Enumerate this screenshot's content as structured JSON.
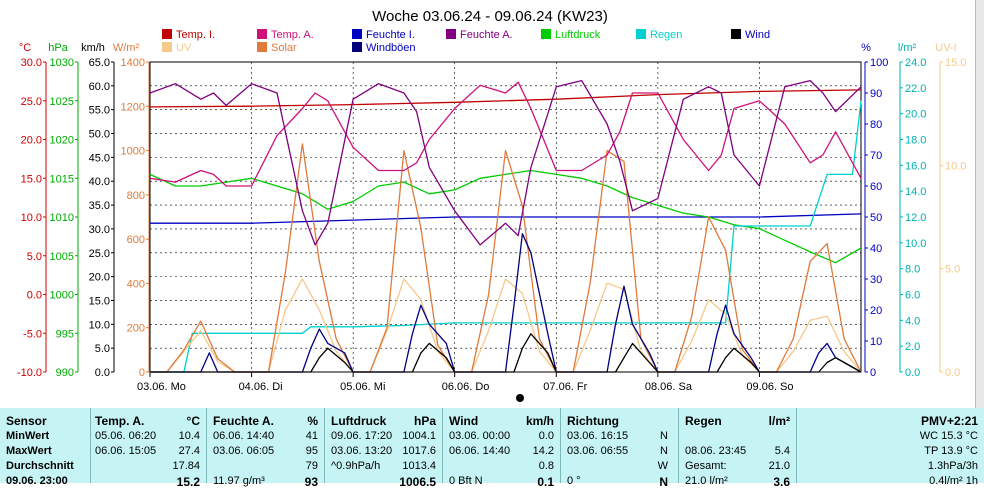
{
  "chart_data": {
    "type": "line",
    "title": "Woche 03.06.24 - 09.06.24 (KW23)",
    "x_ticks": [
      "03.06. Mo",
      "04.06. Di",
      "05.06. Mi",
      "06.06. Do",
      "07.06. Fr",
      "08.06. Sa",
      "09.06. So"
    ],
    "x_range_hours": [
      0,
      168
    ],
    "grid": true,
    "legend_placement": "top",
    "left_axes": [
      {
        "label": "°C",
        "color": "#d00000",
        "range": [
          -10,
          30
        ],
        "ticks": [
          "30.0",
          "25.0",
          "20.0",
          "15.0",
          "10.0",
          "5.0",
          "0.0",
          "-5.0",
          "-10.0"
        ]
      },
      {
        "label": "hPa",
        "color": "#00aa00",
        "range": [
          990,
          1030
        ],
        "ticks": [
          "1030",
          "1025",
          "1020",
          "1015",
          "1010",
          "1005",
          "1000",
          "995",
          "990"
        ]
      },
      {
        "label": "km/h",
        "color": "#000000",
        "range": [
          0,
          65
        ],
        "ticks": [
          "65.0",
          "60.0",
          "55.0",
          "50.0",
          "45.0",
          "40.0",
          "35.0",
          "30.0",
          "25.0",
          "20.0",
          "15.0",
          "10.0",
          "5.0",
          "0.0"
        ]
      },
      {
        "label": "W/m²",
        "color": "#e07a3a",
        "range": [
          0,
          1400
        ],
        "ticks": [
          "1400",
          "1200",
          "1000",
          "800",
          "600",
          "400",
          "200",
          "0"
        ]
      }
    ],
    "right_axes": [
      {
        "label": "%",
        "color": "#0000c0",
        "range": [
          0,
          100
        ],
        "ticks": [
          "100",
          "90",
          "80",
          "70",
          "60",
          "50",
          "40",
          "30",
          "20",
          "10",
          "0"
        ]
      },
      {
        "label": "l/m²",
        "color": "#00b0b0",
        "range": [
          0,
          24
        ],
        "ticks": [
          "24.0",
          "22.0",
          "20.0",
          "18.0",
          "16.0",
          "14.0",
          "12.0",
          "10.0",
          "8.0",
          "6.0",
          "4.0",
          "2.0",
          "0.0"
        ]
      },
      {
        "label": "UV-I",
        "color": "#f5c98a",
        "range": [
          0,
          15
        ],
        "ticks": [
          "15.0",
          "10.0",
          "5.0",
          "0.0"
        ]
      }
    ],
    "series": [
      {
        "name": "Temp. I.",
        "color": "#c00000",
        "axis": "°C",
        "x": [
          0,
          24,
          48,
          72,
          96,
          120,
          144,
          168
        ],
        "y": [
          24.2,
          24.3,
          24.5,
          24.8,
          25.2,
          25.8,
          26.2,
          26.4
        ]
      },
      {
        "name": "Temp. A.",
        "color": "#d0107a",
        "axis": "°C",
        "x": [
          0,
          6,
          12,
          15,
          18,
          24,
          30,
          36,
          39,
          42,
          48,
          54,
          60,
          63,
          66,
          72,
          78,
          84,
          87,
          90,
          96,
          102,
          108,
          111,
          114,
          120,
          126,
          132,
          135,
          138,
          144,
          150,
          156,
          159,
          162,
          168
        ],
        "y": [
          15,
          14.5,
          16,
          15.5,
          14,
          14,
          20.5,
          24,
          26,
          25,
          19,
          16,
          16,
          17,
          20,
          24,
          27,
          26,
          27.4,
          24,
          16,
          16,
          18,
          21,
          26,
          26,
          20,
          16,
          18,
          24,
          25,
          22,
          17,
          18,
          21,
          15
        ]
      },
      {
        "name": "Feuchte I.",
        "color": "#0000c0",
        "axis": "%",
        "x": [
          0,
          24,
          48,
          72,
          96,
          120,
          144,
          168
        ],
        "y": [
          48,
          48,
          49,
          50,
          50,
          50,
          50,
          51
        ]
      },
      {
        "name": "Feuchte A.",
        "color": "#800080",
        "axis": "%",
        "x": [
          0,
          6,
          12,
          15,
          18,
          24,
          30,
          36,
          39,
          42,
          48,
          54,
          60,
          63,
          66,
          72,
          78,
          84,
          87,
          90,
          96,
          102,
          108,
          111,
          114,
          120,
          126,
          132,
          135,
          138,
          144,
          150,
          156,
          159,
          162,
          168
        ],
        "y": [
          90,
          93,
          88,
          90,
          86,
          93,
          90,
          52,
          41,
          48,
          88,
          93,
          90,
          84,
          66,
          52,
          41,
          48,
          44,
          66,
          92,
          94,
          80,
          68,
          52,
          56,
          88,
          92,
          90,
          70,
          60,
          92,
          94,
          90,
          84,
          92
        ]
      },
      {
        "name": "Luftdruck",
        "color": "#00cc00",
        "axis": "hPa",
        "x": [
          0,
          6,
          12,
          18,
          24,
          30,
          36,
          42,
          48,
          54,
          60,
          66,
          72,
          78,
          84,
          90,
          96,
          102,
          108,
          114,
          120,
          126,
          132,
          138,
          144,
          150,
          156,
          162,
          168
        ],
        "y": [
          1015.5,
          1014,
          1014,
          1014.5,
          1015,
          1014,
          1013,
          1011,
          1012,
          1014,
          1014.5,
          1013,
          1013.5,
          1015,
          1015.5,
          1016,
          1015.5,
          1015,
          1014,
          1012.5,
          1011.5,
          1010.5,
          1010,
          1009,
          1008.5,
          1007,
          1005.5,
          1004.1,
          1006
        ]
      },
      {
        "name": "Regen",
        "color": "#00d0d0",
        "axis": "l/m²",
        "x": [
          0,
          8,
          10,
          36,
          38,
          48,
          60,
          72,
          96,
          120,
          132,
          136,
          138,
          156,
          160,
          162,
          166,
          168
        ],
        "y": [
          0,
          0,
          3,
          3,
          3.5,
          3.5,
          3.6,
          3.8,
          3.8,
          3.8,
          3.8,
          3.8,
          11.3,
          11.3,
          15.3,
          15.3,
          15.3,
          21
        ]
      },
      {
        "name": "Wind",
        "color": "#000000",
        "axis": "km/h",
        "x": [
          0,
          38,
          40,
          42,
          46,
          48,
          62,
          64,
          66,
          70,
          72,
          86,
          88,
          90,
          94,
          96,
          110,
          112,
          114,
          118,
          120,
          134,
          136,
          138,
          142,
          144,
          158,
          160,
          162,
          168
        ],
        "y": [
          0,
          0,
          3,
          5,
          2,
          0,
          0,
          4,
          6,
          3,
          0,
          0,
          5,
          8,
          4,
          0,
          0,
          3,
          6,
          2,
          0,
          0,
          3,
          5,
          2,
          0,
          0,
          2,
          3,
          0
        ]
      },
      {
        "name": "Windböen",
        "color": "#000080",
        "axis": "km/h",
        "x": [
          0,
          12,
          14,
          16,
          24,
          36,
          38,
          40,
          42,
          46,
          48,
          60,
          62,
          64,
          66,
          70,
          72,
          84,
          86,
          88,
          90,
          94,
          96,
          108,
          110,
          112,
          114,
          118,
          120,
          132,
          134,
          136,
          138,
          142,
          144,
          156,
          158,
          160,
          162,
          168
        ],
        "y": [
          0,
          0,
          4,
          0,
          0,
          0,
          5,
          9,
          6,
          4,
          0,
          0,
          8,
          14,
          10,
          6,
          0,
          0,
          14,
          29,
          25,
          8,
          0,
          0,
          10,
          18,
          10,
          4,
          0,
          0,
          8,
          14,
          8,
          3,
          0,
          0,
          4,
          6,
          3,
          0
        ]
      },
      {
        "name": "Solar",
        "color": "#e07a3a",
        "axis": "W/m²",
        "x": [
          0,
          4,
          8,
          12,
          16,
          20,
          28,
          32,
          36,
          40,
          44,
          48,
          52,
          56,
          60,
          64,
          68,
          72,
          76,
          80,
          84,
          88,
          92,
          96,
          100,
          104,
          108,
          112,
          116,
          120,
          124,
          128,
          132,
          136,
          140,
          144,
          148,
          152,
          156,
          160,
          164,
          168
        ],
        "y": [
          0,
          0,
          100,
          230,
          60,
          0,
          0,
          450,
          1030,
          500,
          150,
          0,
          0,
          200,
          1000,
          650,
          120,
          0,
          0,
          350,
          1000,
          750,
          150,
          0,
          0,
          400,
          1000,
          950,
          150,
          0,
          0,
          250,
          700,
          550,
          100,
          0,
          0,
          150,
          500,
          580,
          150,
          0
        ]
      },
      {
        "name": "UV",
        "color": "#f5c98a",
        "axis": "UV-I",
        "x": [
          0,
          4,
          8,
          12,
          16,
          20,
          28,
          32,
          36,
          40,
          44,
          48,
          52,
          56,
          60,
          64,
          68,
          72,
          76,
          80,
          84,
          88,
          92,
          96,
          100,
          104,
          108,
          112,
          116,
          120,
          124,
          128,
          132,
          136,
          140,
          144,
          148,
          152,
          156,
          160,
          164,
          168
        ],
        "y": [
          0,
          0,
          1,
          2,
          0.5,
          0,
          0,
          3,
          4.5,
          3,
          1,
          0,
          0,
          2,
          4.5,
          3.5,
          1,
          0,
          0,
          2,
          4.5,
          3.8,
          1,
          0,
          0,
          2,
          4.3,
          4,
          1,
          0,
          0,
          1.5,
          3.5,
          2.8,
          0.8,
          0,
          0,
          1,
          2.5,
          2.7,
          1,
          0
        ]
      }
    ],
    "legend": [
      "Temp. I.",
      "Temp. A.",
      "Feuchte I.",
      "Feuchte A.",
      "Luftdruck",
      "Regen",
      "Wind",
      "UV",
      "Solar",
      "Windböen"
    ]
  },
  "stats": {
    "sensor": {
      "header": "Sensor",
      "rows": [
        "MinWert",
        "MaxWert",
        "Durchschnitt",
        "09.06. 23:00"
      ]
    },
    "temp": {
      "header": "Temp. A.",
      "unit": "°C",
      "rows": [
        [
          "05.06.  06:20",
          "10.4"
        ],
        [
          "06.06.  15:05",
          "27.4"
        ],
        [
          "",
          "17.84"
        ],
        [
          "",
          "15.2"
        ]
      ]
    },
    "feuchte": {
      "header": "Feuchte A.",
      "unit": "%",
      "rows": [
        [
          "06.06.  14:40",
          "41"
        ],
        [
          "03.06.  06:05",
          "95"
        ],
        [
          "",
          "79"
        ],
        [
          "11.97 g/m³",
          "93"
        ]
      ]
    },
    "luftdruck": {
      "header": "Luftdruck",
      "unit": "hPa",
      "rows": [
        [
          "09.06.  17:20",
          "1004.1"
        ],
        [
          "03.06.  13:20",
          "1017.6"
        ],
        [
          "^0.9hPa/h",
          "1013.4"
        ],
        [
          "",
          "1006.5"
        ]
      ]
    },
    "wind": {
      "header": "Wind",
      "unit": "km/h",
      "rows": [
        [
          "03.06.  00:00",
          "0.0"
        ],
        [
          "06.06.  14:40",
          "14.2"
        ],
        [
          "",
          "0.8"
        ],
        [
          "0 Bft N",
          "0.1"
        ]
      ]
    },
    "richtung": {
      "header": "Richtung",
      "rows": [
        [
          "03.06.  16:15",
          "N"
        ],
        [
          "03.06.  06:55",
          "N"
        ],
        [
          "",
          "W"
        ],
        [
          "0 °",
          "N"
        ]
      ]
    },
    "regen": {
      "header": "Regen",
      "unit": "l/m²",
      "rows": [
        [
          "",
          ""
        ],
        [
          "08.06.  23:45",
          "5.4"
        ],
        [
          "Gesamt:",
          "21.0"
        ],
        [
          "21.0 l/m²",
          "3.6"
        ]
      ]
    },
    "pmv": {
      "header": "PMV+2:21",
      "rows": [
        "WC 15.3 °C",
        "TP 13.9 °C",
        "1.3hPa/3h",
        "0.4l/m² 1h"
      ]
    }
  }
}
